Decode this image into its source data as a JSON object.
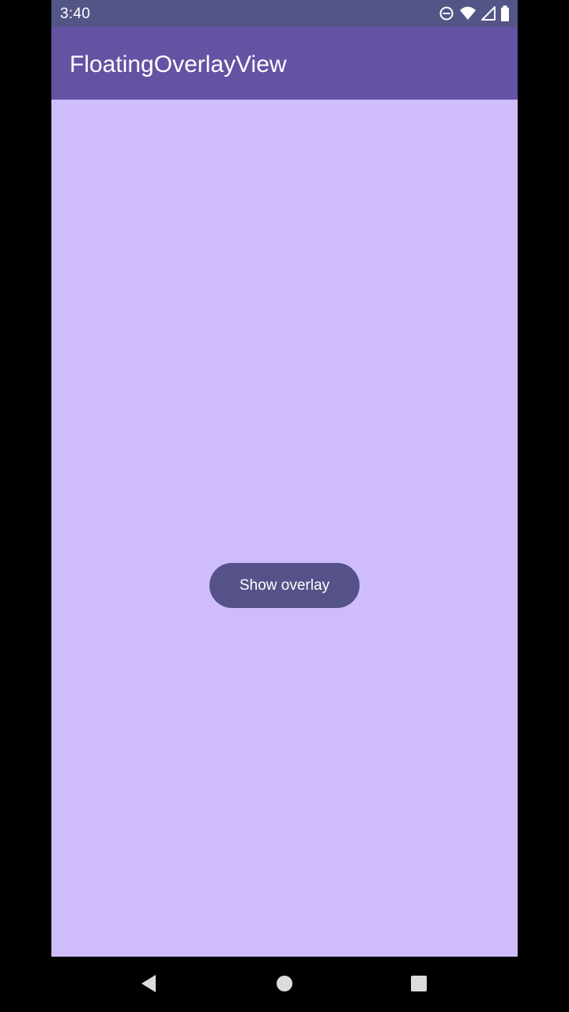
{
  "status_bar": {
    "time": "3:40",
    "icons": [
      "do-not-disturb-icon",
      "wifi-icon",
      "cell-signal-icon",
      "battery-icon"
    ]
  },
  "app_bar": {
    "title": "FloatingOverlayView"
  },
  "main": {
    "show_overlay_label": "Show overlay"
  },
  "nav_bar": {
    "icons": [
      "back-icon",
      "home-icon",
      "recents-icon"
    ]
  },
  "colors": {
    "status_bar": "#545587",
    "app_bar": "#6552a3",
    "background": "#cfbdfb",
    "button": "#555289",
    "text_on_dark": "#ffffff"
  }
}
